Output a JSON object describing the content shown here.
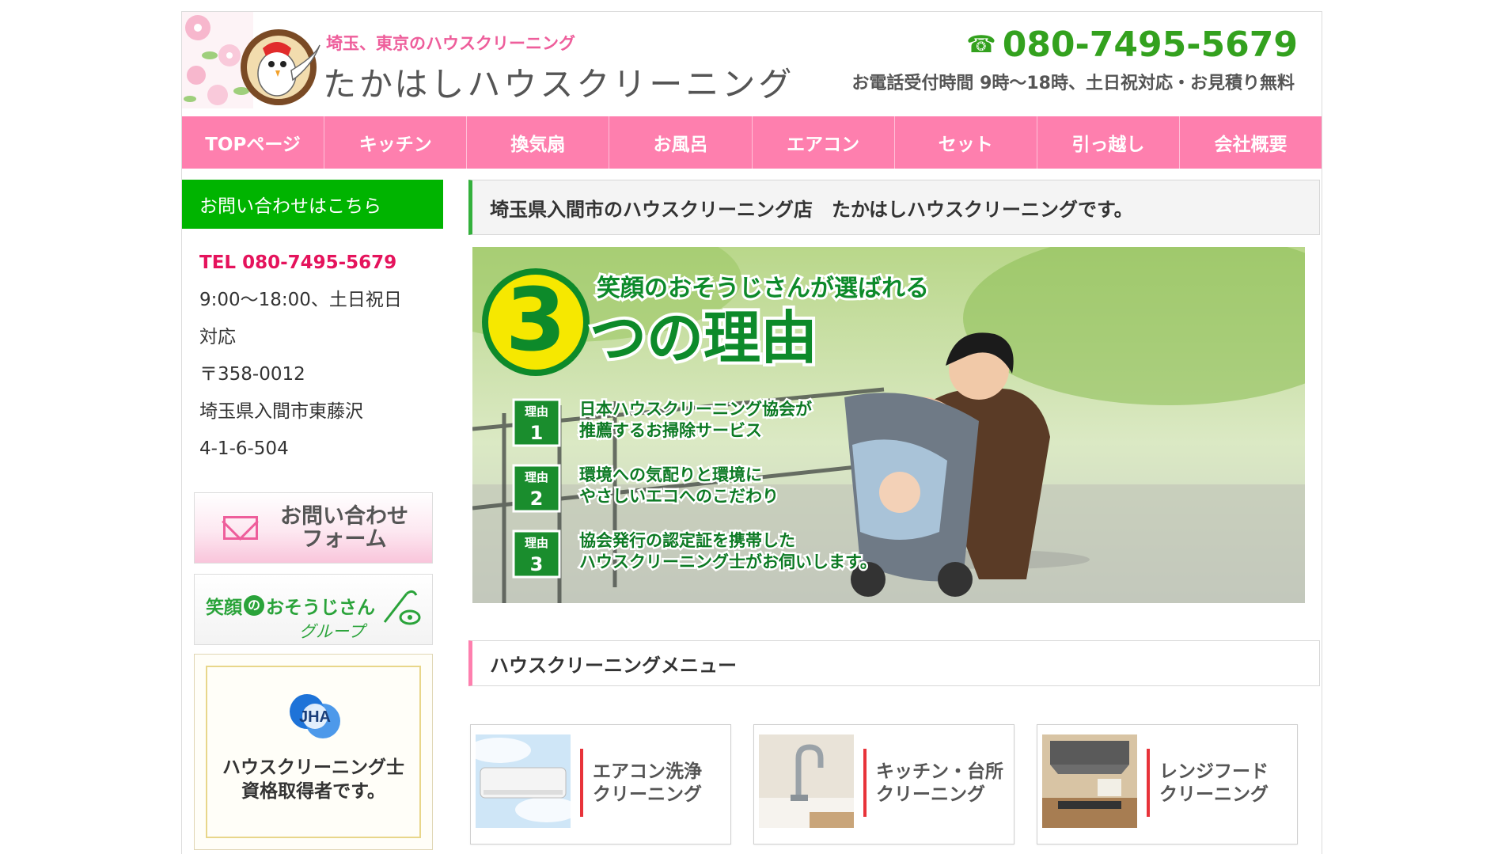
{
  "header": {
    "subtitle": "埼玉、東京のハウスクリーニング",
    "title": "たかはしハウスクリーニング",
    "phone": "080-7495-5679",
    "phone_icon": "telephone-icon",
    "hours": "お電話受付時間 9時〜18時、土日祝対応・お見積り無料"
  },
  "nav": {
    "items": [
      "TOPページ",
      "キッチン",
      "換気扇",
      "お風呂",
      "エアコン",
      "セット",
      "引っ越し",
      "会社概要"
    ]
  },
  "sidebar": {
    "heading": "お問い合わせはこちら",
    "tel": "TEL 080-7495-5679",
    "hours1": "9:00〜18:00、土日祝日",
    "hours2": "対応",
    "postal": "〒358-0012",
    "address1": "埼玉県入間市東藤沢",
    "address2": "4-1-6-504",
    "contact_banner": {
      "line1": "お問い合わせ",
      "line2": "フォーム"
    },
    "group_banner": {
      "part1": "笑顔",
      "part2": "の",
      "part3": "おそうじさん",
      "line2": "グループ"
    },
    "cert_banner": {
      "logo": "JHA",
      "line1": "ハウスクリーニング士",
      "line2": "資格取得者です。"
    }
  },
  "main": {
    "heading": "埼玉県入間市のハウスクリーニング店　たかはしハウスクリーニングです。",
    "hero": {
      "number": "3",
      "tagline": "笑顔のおそうじさんが選ばれる",
      "title": "つの理由",
      "reason_label": "理由",
      "reasons": [
        {
          "num": "1",
          "line1": "日本ハウスクリーニング協会が",
          "line2": "推薦するお掃除サービス"
        },
        {
          "num": "2",
          "line1": "環境への気配りと環境に",
          "line2": "やさしいエコへのこだわり"
        },
        {
          "num": "3",
          "line1": "協会発行の認定証を携帯した",
          "line2": "ハウスクリーニング士がお伺いします。"
        }
      ]
    },
    "menu_heading": "ハウスクリーニングメニュー",
    "menu": [
      {
        "line1": "エアコン洗浄",
        "line2": "クリーニング"
      },
      {
        "line1": "キッチン・台所",
        "line2": "クリーニング"
      },
      {
        "line1": "レンジフード",
        "line2": "クリーニング"
      }
    ]
  },
  "colors": {
    "nav_pink": "#fe7fae",
    "green": "#00b400",
    "phone_green": "#33a11e",
    "tel_red": "#e5135c"
  }
}
